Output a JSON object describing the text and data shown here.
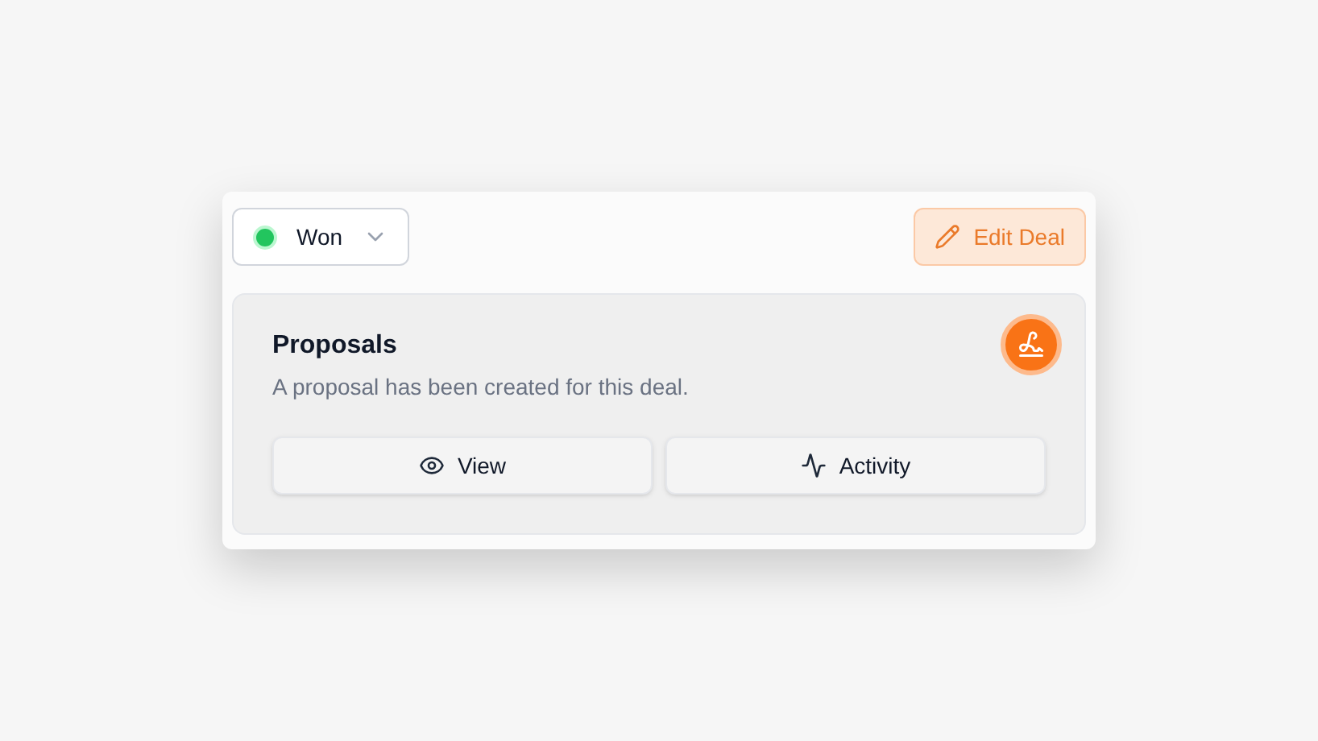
{
  "status": {
    "label": "Won",
    "color": "#22c55e"
  },
  "edit_button": {
    "label": "Edit Deal"
  },
  "section": {
    "title": "Proposals",
    "description": "A proposal has been created for this deal.",
    "actions": [
      {
        "kind": "view",
        "label": "View"
      },
      {
        "kind": "activity",
        "label": "Activity"
      }
    ]
  }
}
